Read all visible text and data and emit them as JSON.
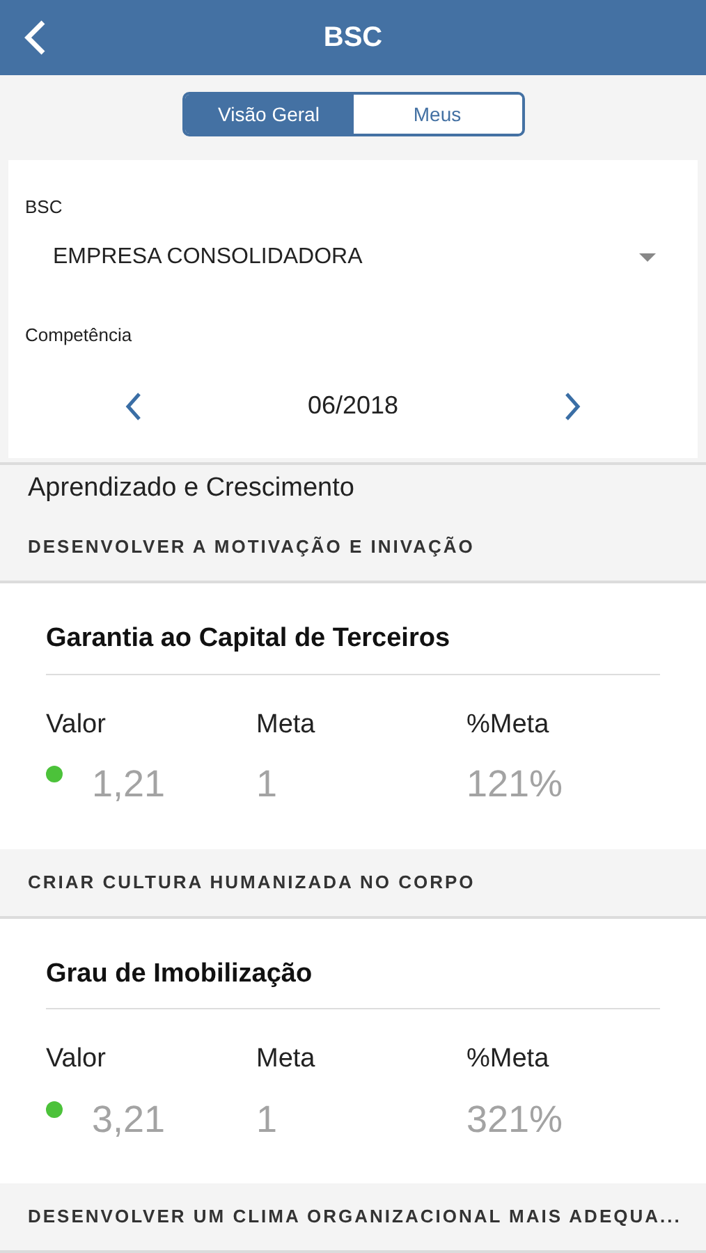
{
  "header": {
    "title": "BSC"
  },
  "tabs": [
    {
      "label": "Visão Geral",
      "selected": true
    },
    {
      "label": "Meus",
      "selected": false
    }
  ],
  "filters": {
    "bsc_label": "BSC",
    "bsc_value": "EMPRESA CONSOLIDADORA",
    "period_label": "Competência",
    "period_value": "06/2018"
  },
  "perspective": "Aprendizado e Crescimento",
  "objectives": [
    {
      "title": "DESENVOLVER A MOTIVAÇÃO E INIVAÇÃO",
      "indicators": [
        {
          "name": "Garantia ao Capital de Terceiros",
          "value_label": "Valor",
          "goal_label": "Meta",
          "pct_label": "%Meta",
          "value": "1,21",
          "goal": "1",
          "pct": "121%",
          "color": "#4cc23a"
        }
      ]
    },
    {
      "title": "CRIAR CULTURA HUMANIZADA NO CORPO",
      "indicators": [
        {
          "name": "Grau de Imobilização",
          "value_label": "Valor",
          "goal_label": "Meta",
          "pct_label": "%Meta",
          "value": "3,21",
          "goal": "1",
          "pct": "321%",
          "color": "#4cc23a"
        }
      ]
    },
    {
      "title": "DESENVOLVER UM CLIMA ORGANIZACIONAL MAIS ADEQUA..."
    }
  ]
}
